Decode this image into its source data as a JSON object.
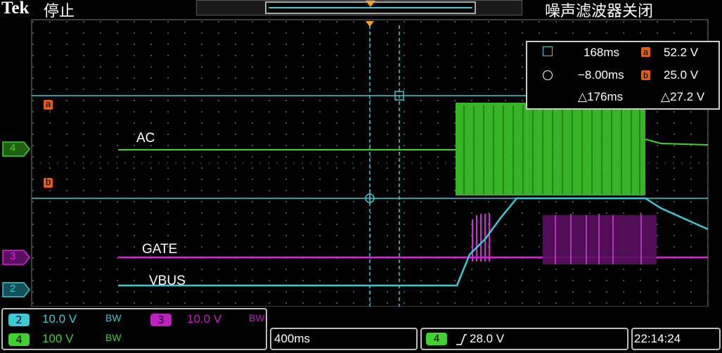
{
  "header": {
    "brand": "Tek",
    "run_state": "停止",
    "filter_status": "噪声滤波器关闭"
  },
  "measurements": {
    "cursor1_icon": "square-cursor-icon",
    "cursor1_time": "168ms",
    "cursor1_ref": "a",
    "cursor1_value": "52.2 V",
    "cursor2_icon": "circle-cursor-icon",
    "cursor2_time": "−8.00ms",
    "cursor2_ref": "b",
    "cursor2_value": "25.0 V",
    "delta_time": "△176ms",
    "delta_value": "△27.2 V"
  },
  "markers": {
    "ref_a": "a",
    "ref_b": "b",
    "ch4": "4",
    "ch3": "3",
    "ch2": "2"
  },
  "trace_labels": {
    "ac": "AC",
    "gate": "GATE",
    "vbus": "VBUS"
  },
  "channels": {
    "ch2": {
      "num": "2",
      "scale": "10.0 V",
      "bw": "BW",
      "color": "#3cc9d6"
    },
    "ch3": {
      "num": "3",
      "scale": "10.0 V",
      "bw": "BW",
      "color": "#e020e0"
    },
    "ch4": {
      "num": "4",
      "scale": "100 V",
      "bw": "BW",
      "color": "#3fd22e"
    }
  },
  "timebase": "400ms",
  "trigger": {
    "source": "4",
    "slope_icon": "rising-edge-icon",
    "level": "28.0 V"
  },
  "clock": "22:14:24"
}
